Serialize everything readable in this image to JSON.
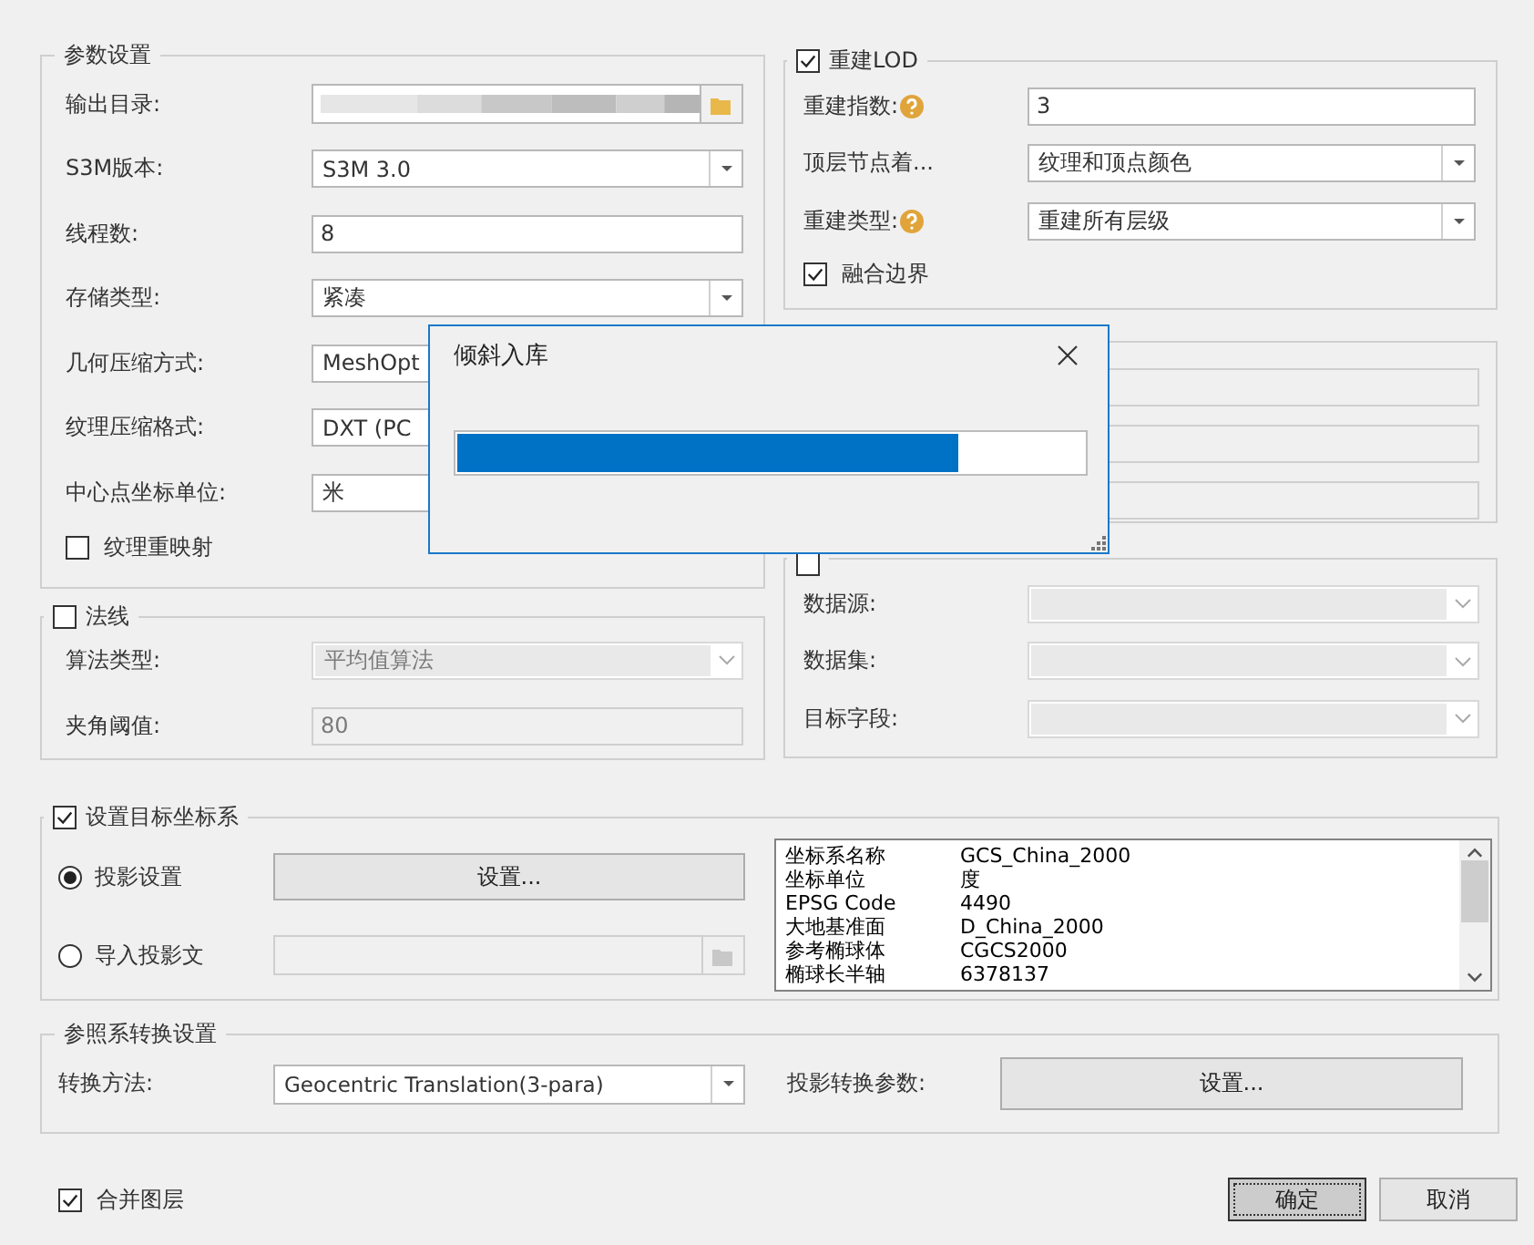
{
  "params": {
    "title": "参数设置",
    "rows": [
      {
        "label": "输出目录:",
        "kind": "browse"
      },
      {
        "label": "S3M版本:",
        "kind": "combo",
        "value": "S3M 3.0"
      },
      {
        "label": "线程数:",
        "kind": "text",
        "value": "8"
      },
      {
        "label": "存储类型:",
        "kind": "combo",
        "value": "紧凑"
      },
      {
        "label": "几何压缩方式:",
        "kind": "combo",
        "value": "MeshOpt"
      },
      {
        "label": "纹理压缩格式:",
        "kind": "combo",
        "value": "DXT (PC"
      },
      {
        "label": "中心点坐标单位:",
        "kind": "combo",
        "value": "米"
      }
    ],
    "texture_remap": {
      "label": "纹理重映射",
      "checked": false
    }
  },
  "normals": {
    "title": "法线",
    "checked": false,
    "rows": [
      {
        "label": "算法类型:",
        "kind": "combo",
        "value": "平均值算法",
        "disabled": true
      },
      {
        "label": "夹角阈值:",
        "kind": "text",
        "value": "80",
        "disabled": true
      }
    ]
  },
  "lod": {
    "title": "重建LOD",
    "checked": true,
    "rows": [
      {
        "label": "重建指数:",
        "help": true,
        "kind": "text",
        "value": "3"
      },
      {
        "label": "顶层节点着...",
        "help": false,
        "kind": "combo",
        "value": "纹理和顶点颜色"
      },
      {
        "label": "重建类型:",
        "help": true,
        "kind": "combo",
        "value": "重建所有层级"
      }
    ],
    "merge_border": {
      "label": "融合边界",
      "checked": true
    }
  },
  "covered_group": {
    "fields": [
      {
        "disabled": true
      },
      {
        "disabled": true
      },
      {
        "disabled": true
      }
    ]
  },
  "monomer": {
    "checked": false,
    "rows": [
      {
        "label": "数据源:",
        "kind": "combo",
        "disabled": true
      },
      {
        "label": "数据集:",
        "kind": "combo",
        "disabled": true
      },
      {
        "label": "目标字段:",
        "kind": "combo",
        "disabled": true
      }
    ]
  },
  "target_crs": {
    "title": "设置目标坐标系",
    "checked": true,
    "options": [
      {
        "label": "投影设置",
        "selected": true,
        "kind": "button",
        "button": "设置..."
      },
      {
        "label": "导入投影文",
        "selected": false,
        "kind": "file"
      }
    ],
    "info": [
      {
        "key": "坐标系名称",
        "value": "GCS_China_2000"
      },
      {
        "key": "坐标单位",
        "value": "度"
      },
      {
        "key": "EPSG Code",
        "value": "4490"
      },
      {
        "key": "大地基准面",
        "value": "D_China_2000"
      },
      {
        "key": "参考椭球体",
        "value": "CGCS2000"
      },
      {
        "key": "椭球长半轴",
        "value": "6378137"
      }
    ]
  },
  "transform": {
    "title": "参照系转换设置",
    "method_label": "转换方法:",
    "method": "Geocentric Translation(3-para)",
    "params_label": "投影转换参数:",
    "params_button": "设置..."
  },
  "merge_layers": {
    "label": "合并图层",
    "checked": true
  },
  "buttons": [
    {
      "label": "确定",
      "default": true
    },
    {
      "label": "取消",
      "default": false
    }
  ],
  "progress_dialog": {
    "title": "倾斜入库",
    "level": 0.8
  }
}
